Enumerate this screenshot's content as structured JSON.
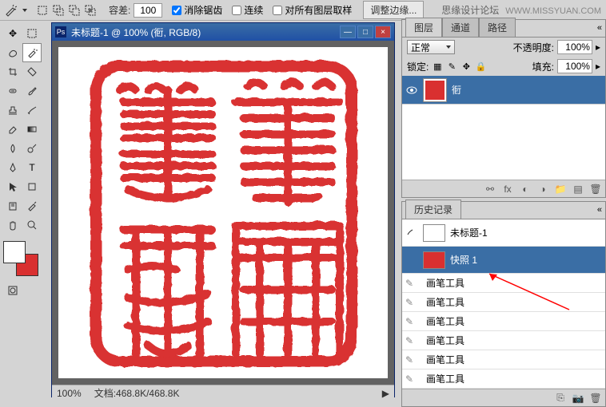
{
  "watermark": {
    "text": "思缘设计论坛",
    "url": "WWW.MISSYUAN.COM"
  },
  "options_bar": {
    "tolerance_label": "容差:",
    "tolerance_value": "100",
    "antialias_label": "消除锯齿",
    "contiguous_label": "连续",
    "sample_all_label": "对所有图层取样",
    "refine_edge_label": "调整边缘..."
  },
  "document": {
    "title": "未标题-1 @ 100% (衐, RGB/8)",
    "zoom": "100%",
    "doc_size_label": "文档:",
    "doc_size": "468.8K/468.8K"
  },
  "layers_panel": {
    "tabs": [
      "图层",
      "通道",
      "路径"
    ],
    "mode_label": "正常",
    "opacity_label": "不透明度:",
    "opacity_value": "100%",
    "lock_label": "锁定:",
    "fill_label": "填充:",
    "fill_value": "100%",
    "layers": [
      {
        "name": "衐"
      }
    ]
  },
  "history_panel": {
    "tab": "历史记录",
    "items": [
      {
        "name": "未标题-1",
        "thumb": true
      },
      {
        "name": "快照 1",
        "thumb": true,
        "selected": true
      },
      {
        "name": "画笔工具"
      },
      {
        "name": "画笔工具"
      },
      {
        "name": "画笔工具"
      },
      {
        "name": "画笔工具"
      },
      {
        "name": "画笔工具"
      },
      {
        "name": "画笔工具"
      }
    ]
  },
  "colors": {
    "seal_red": "#d93030"
  }
}
